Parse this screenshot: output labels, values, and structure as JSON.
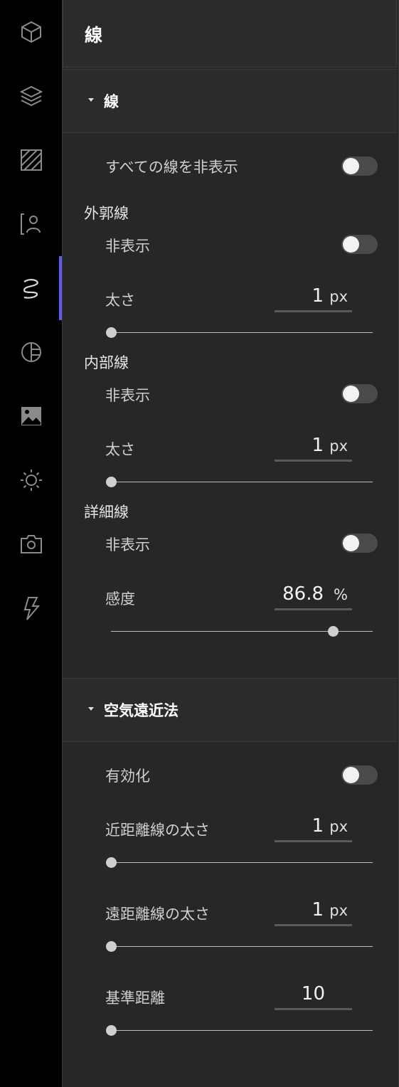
{
  "rail": {
    "items": [
      {
        "icon": "cube-icon"
      },
      {
        "icon": "layers-icon"
      },
      {
        "icon": "texture-icon"
      },
      {
        "icon": "character-icon"
      },
      {
        "icon": "line-icon",
        "active": true
      },
      {
        "icon": "tone-icon"
      },
      {
        "icon": "image-icon"
      },
      {
        "icon": "light-icon"
      },
      {
        "icon": "camera-icon"
      },
      {
        "icon": "effect-icon"
      }
    ],
    "accent": "#5b5bf0"
  },
  "panel": {
    "title": "線"
  },
  "lines_section": {
    "title": "線",
    "hide_all_label": "すべての線を非表示",
    "hide_all_on": false,
    "outline": {
      "title": "外郭線",
      "hide_label": "非表示",
      "hide_on": false,
      "width_label": "太さ",
      "width_value": "1",
      "width_unit": "px",
      "slider_fraction": 0.0
    },
    "inner": {
      "title": "内部線",
      "hide_label": "非表示",
      "hide_on": false,
      "width_label": "太さ",
      "width_value": "1",
      "width_unit": "px",
      "slider_fraction": 0.0
    },
    "detail": {
      "title": "詳細線",
      "hide_label": "非表示",
      "hide_on": false,
      "sensitivity_label": "感度",
      "sensitivity_value": "86.8",
      "sensitivity_unit": "%",
      "slider_fraction": 0.868
    }
  },
  "aerial_section": {
    "title": "空気遠近法",
    "enable_label": "有効化",
    "enable_on": false,
    "near_label": "近距離線の太さ",
    "near_value": "1",
    "near_unit": "px",
    "near_fraction": 0.0,
    "far_label": "遠距離線の太さ",
    "far_value": "1",
    "far_unit": "px",
    "far_fraction": 0.0,
    "base_label": "基準距離",
    "base_value": "10",
    "base_fraction": 0.0
  }
}
